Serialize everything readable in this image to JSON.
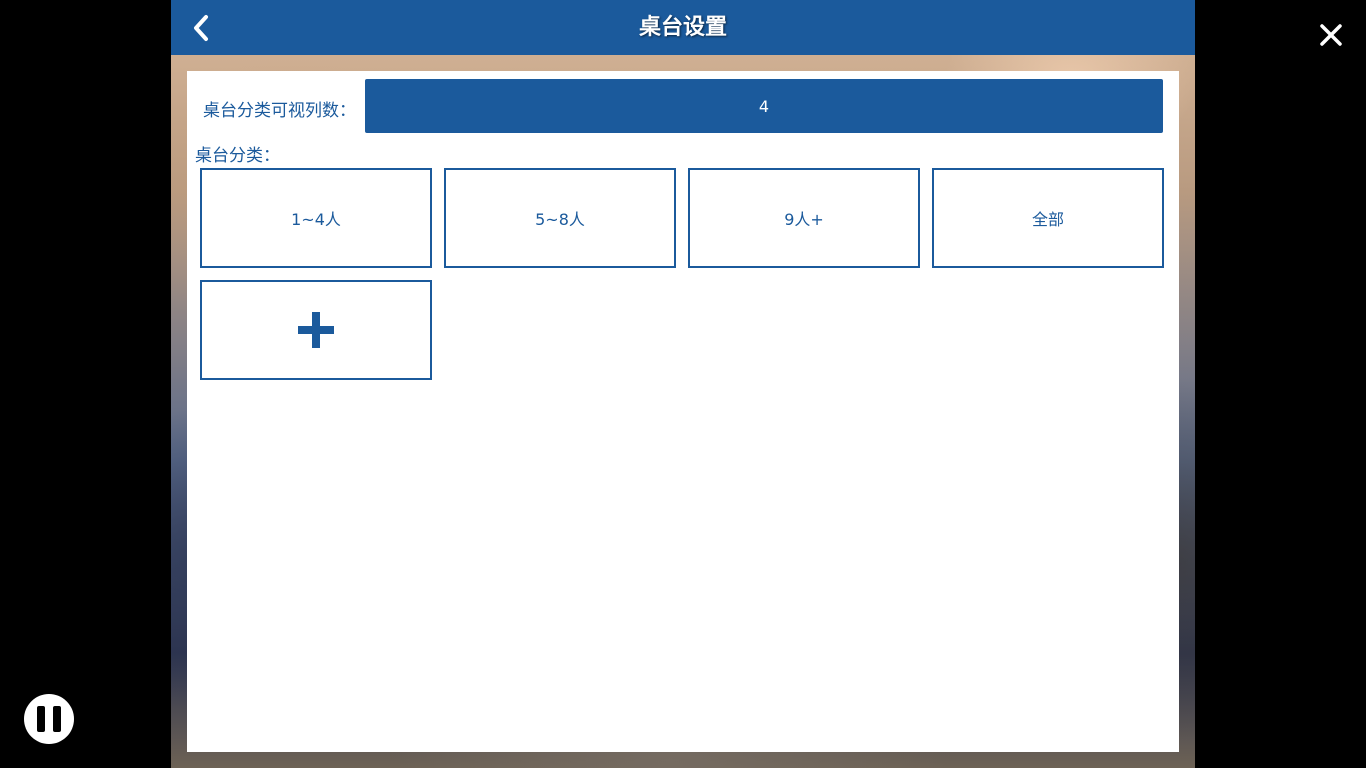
{
  "header": {
    "title": "桌台设置",
    "back_icon": "chevron-left-icon"
  },
  "settings": {
    "visible_columns_label": "桌台分类可视列数：",
    "visible_columns_value": "4",
    "categories_label": "桌台分类："
  },
  "categories": [
    {
      "label": "1~4人"
    },
    {
      "label": "5~8人"
    },
    {
      "label": "9人+"
    },
    {
      "label": "全部"
    }
  ],
  "add_button": {
    "icon": "plus-icon"
  },
  "overlay": {
    "close_icon": "close-icon",
    "pause_icon": "pause-icon"
  },
  "colors": {
    "accent": "#1b5a9c",
    "panel_bg": "#ffffff",
    "text_on_accent": "#ffffff"
  }
}
